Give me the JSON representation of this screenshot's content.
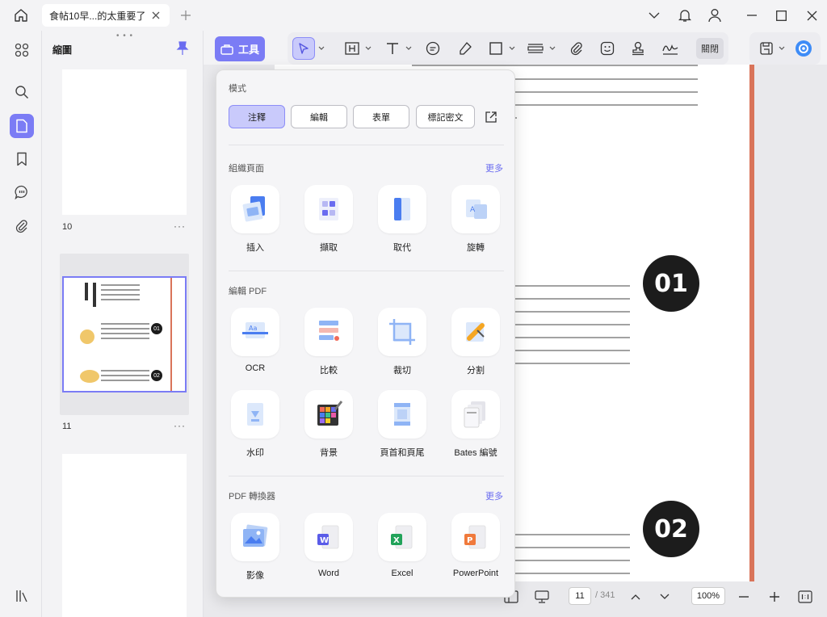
{
  "titlebar": {
    "tab_title": "食帖10早...的太重要了"
  },
  "thumbnails": {
    "title": "縮圖",
    "pages": [
      {
        "number": "10",
        "more": "···"
      },
      {
        "number": "11",
        "more": "···"
      }
    ],
    "page11_labels": {
      "h1": "01",
      "h2": "02"
    }
  },
  "toolbar": {
    "tools_label": "工具",
    "close_label": "關閉"
  },
  "popup": {
    "mode": {
      "title": "模式",
      "buttons": [
        "注釋",
        "編輯",
        "表單",
        "標記密文"
      ]
    },
    "organize": {
      "title": "組織頁面",
      "more": "更多",
      "tools": [
        "插入",
        "擷取",
        "取代",
        "旋轉"
      ]
    },
    "edit": {
      "title": "編輯 PDF",
      "tools": [
        "OCR",
        "比較",
        "裁切",
        "分割",
        "水印",
        "背景",
        "頁首和頁尾",
        "Bates 編號"
      ]
    },
    "converter": {
      "title": "PDF 轉換器",
      "more": "更多",
      "tools": [
        "影像",
        "Word",
        "Excel",
        "PowerPoint"
      ]
    }
  },
  "document": {
    "heading_1": "01",
    "heading_2": "02"
  },
  "bottom": {
    "page_current": "11",
    "page_total": "/ 341",
    "zoom": "100%"
  },
  "colors": {
    "accent": "#7b7cf5",
    "accent_light": "#c9cafb",
    "rule": "#d9745a"
  }
}
